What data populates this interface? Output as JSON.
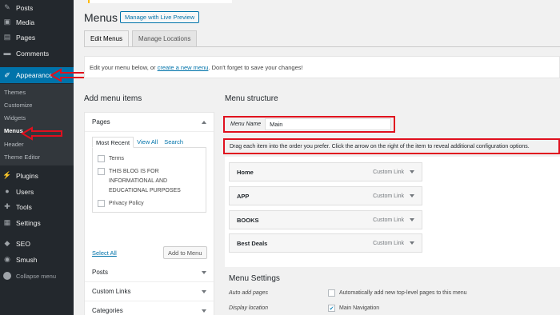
{
  "sidebar": {
    "items": [
      {
        "label": "Posts",
        "icon": "pin-icon"
      },
      {
        "label": "Media",
        "icon": "media-icon"
      },
      {
        "label": "Pages",
        "icon": "pages-icon"
      },
      {
        "label": "Comments",
        "icon": "comments-icon"
      },
      {
        "label": "Appearance",
        "icon": "brush-icon"
      },
      {
        "label": "Plugins",
        "icon": "plugin-icon"
      },
      {
        "label": "Users",
        "icon": "users-icon"
      },
      {
        "label": "Tools",
        "icon": "wrench-icon"
      },
      {
        "label": "Settings",
        "icon": "settings-icon"
      },
      {
        "label": "SEO",
        "icon": "seo-icon"
      },
      {
        "label": "Smush",
        "icon": "smush-icon"
      }
    ],
    "submenu": [
      "Themes",
      "Customize",
      "Widgets",
      "Menus",
      "Header",
      "Theme Editor"
    ],
    "collapse": "Collapse menu"
  },
  "header": {
    "title": "Menus",
    "live_preview": "Manage with Live Preview"
  },
  "tabs": [
    "Edit Menus",
    "Manage Locations"
  ],
  "notice": {
    "before": "Edit your menu below, or ",
    "link": "create a new menu",
    "after": ". Don't forget to save your changes!"
  },
  "add_items": {
    "heading": "Add menu items",
    "pages_title": "Pages",
    "subtabs": [
      "Most Recent",
      "View All",
      "Search"
    ],
    "pages": [
      "Terms",
      "THIS BLOG IS FOR INFORMATIONAL AND EDUCATIONAL PURPOSES",
      "Privacy Policy"
    ],
    "select_all": "Select All",
    "add_button": "Add to Menu",
    "sections": [
      "Posts",
      "Custom Links",
      "Categories"
    ]
  },
  "structure": {
    "heading": "Menu structure",
    "name_label": "Menu Name",
    "name_value": "Main",
    "instructions": "Drag each item into the order you prefer. Click the arrow on the right of the item to reveal additional configuration options.",
    "items": [
      {
        "title": "Home",
        "type": "Custom Link"
      },
      {
        "title": "APP",
        "type": "Custom Link"
      },
      {
        "title": "BOOKS",
        "type": "Custom Link"
      },
      {
        "title": "Best Deals",
        "type": "Custom Link"
      }
    ]
  },
  "settings": {
    "heading": "Menu Settings",
    "auto_label": "Auto add pages",
    "auto_text": "Automatically add new top-level pages to this menu",
    "location_label": "Display location",
    "location_text": "Main Navigation"
  },
  "colors": {
    "sidebar_bg": "#23282d",
    "active_bg": "#0073aa",
    "annotation": "#e0101e",
    "link": "#0073aa"
  }
}
